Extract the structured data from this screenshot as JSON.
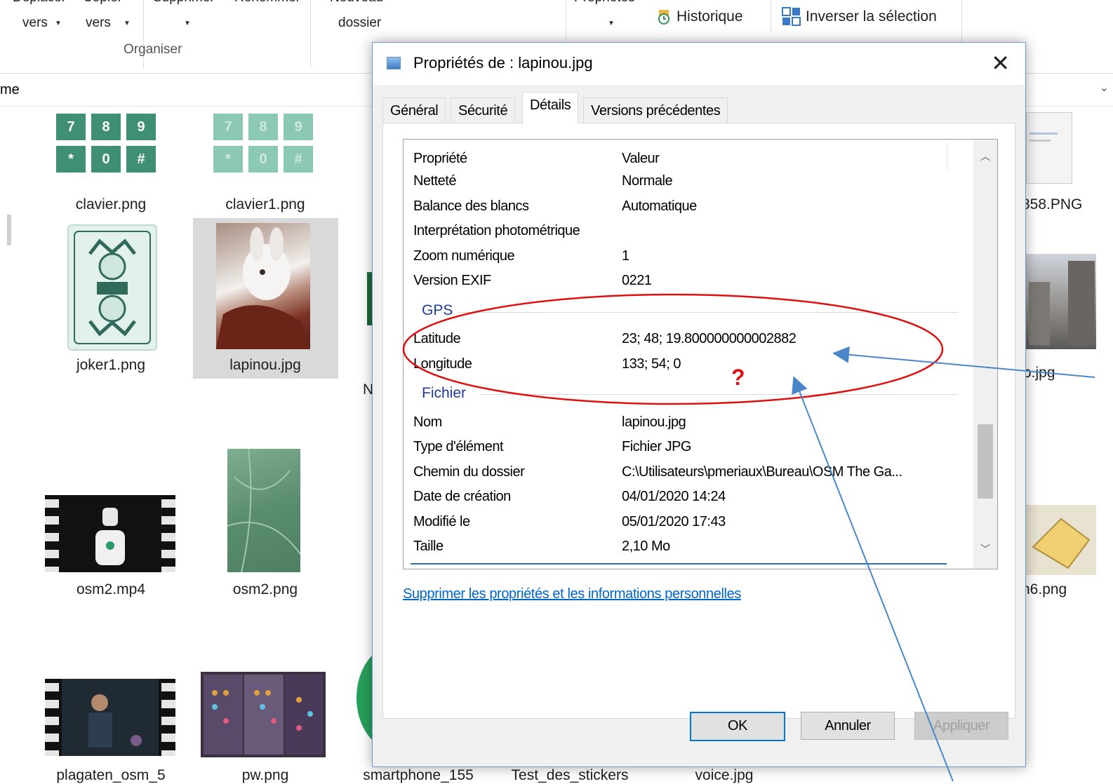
{
  "ribbon": {
    "cut_labels": [
      "Déplacer",
      "Copier",
      "Supprimer",
      "Renommer",
      "Nouveau",
      "Propriétés"
    ],
    "move_to": "vers",
    "copy_to": "vers",
    "new_folder": "dossier",
    "organize_group": "Organiser",
    "history": "Historique",
    "invert_selection": "Inverser la sélection"
  },
  "address": {
    "crumb": "me"
  },
  "files": [
    {
      "name": "clavier.png"
    },
    {
      "name": "clavier1.png"
    },
    {
      "name": "joker1.png"
    },
    {
      "name": "lapinou.jpg"
    },
    {
      "name": "osm2.mp4"
    },
    {
      "name": "osm2.png"
    },
    {
      "name": "plagaten_osm_5"
    },
    {
      "name": "pw.png"
    },
    {
      "name": "smartphone_155"
    },
    {
      "name": "Test_des_stickers"
    },
    {
      "name": "voice.jpg"
    }
  ],
  "right_edge_labels": [
    "358.PNG",
    "o.jpg",
    "n6.png"
  ],
  "partial_letter": "N",
  "keypad": [
    "7",
    "8",
    "9",
    "*",
    "0",
    "#"
  ],
  "dialog": {
    "title": "Propriétés de : lapinou.jpg",
    "close": "✕",
    "tabs": [
      "Général",
      "Sécurité",
      "Détails",
      "Versions précédentes"
    ],
    "active_tab": "Détails",
    "header": {
      "property": "Propriété",
      "value": "Valeur"
    },
    "rows_top": [
      {
        "k": "Netteté",
        "v": "Normale"
      },
      {
        "k": "Balance des blancs",
        "v": "Automatique"
      },
      {
        "k": "Interprétation photométrique",
        "v": ""
      },
      {
        "k": "Zoom numérique",
        "v": "1"
      },
      {
        "k": "Version EXIF",
        "v": "0221"
      }
    ],
    "group_gps": "GPS",
    "rows_gps": [
      {
        "k": "Latitude",
        "v": "23; 48; 19.800000000002882"
      },
      {
        "k": "Longitude",
        "v": "133; 54; 0"
      }
    ],
    "group_file": "Fichier",
    "rows_file": [
      {
        "k": "Nom",
        "v": "lapinou.jpg"
      },
      {
        "k": "Type d'élément",
        "v": "Fichier JPG"
      },
      {
        "k": "Chemin du dossier",
        "v": "C:\\Utilisateurs\\pmeriaux\\Bureau\\OSM The Ga..."
      },
      {
        "k": "Date de création",
        "v": "04/01/2020 14:24"
      },
      {
        "k": "Modifié le",
        "v": "05/01/2020 17:43"
      },
      {
        "k": "Taille",
        "v": "2,10 Mo"
      }
    ],
    "remove_link": "Supprimer les propriétés et les informations personnelles",
    "buttons": {
      "ok": "OK",
      "cancel": "Annuler",
      "apply": "Appliquer"
    }
  },
  "annotation": {
    "question_mark": "?",
    "ellipse_color": "#e01010",
    "arrow_color": "#4a86c8"
  }
}
